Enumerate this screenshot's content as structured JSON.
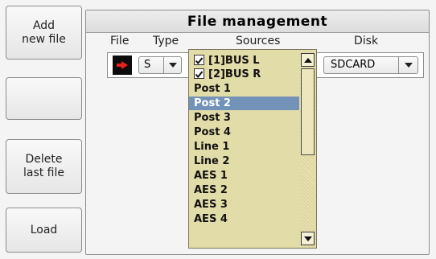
{
  "side_buttons": {
    "add_line1": "Add",
    "add_line2": "new file",
    "empty_label": "",
    "delete_line1": "Delete",
    "delete_line2": "last file",
    "load_label": "Load"
  },
  "panel": {
    "title": "File management",
    "columns": {
      "file": "File",
      "type": "Type",
      "sources": "Sources",
      "disk": "Disk"
    }
  },
  "row": {
    "file_icon": "red-arrow-icon",
    "type_value": "S",
    "disk_value": "SDCARD"
  },
  "sources_dropdown": {
    "items": [
      {
        "label": "[1]BUS L",
        "checkbox": true,
        "checked": true
      },
      {
        "label": "[2]BUS R",
        "checkbox": true,
        "checked": true
      },
      {
        "label": "Post 1"
      },
      {
        "label": "Post 2",
        "selected": true
      },
      {
        "label": "Post 3"
      },
      {
        "label": "Post 4"
      },
      {
        "label": "Line 1"
      },
      {
        "label": "Line 2"
      },
      {
        "label": "AES 1"
      },
      {
        "label": "AES 2"
      },
      {
        "label": "AES 3"
      },
      {
        "label": "AES 4"
      }
    ]
  },
  "colors": {
    "list_bg": "#e2dca8",
    "selection": "#7392b8",
    "arrow_red": "#e82020"
  }
}
